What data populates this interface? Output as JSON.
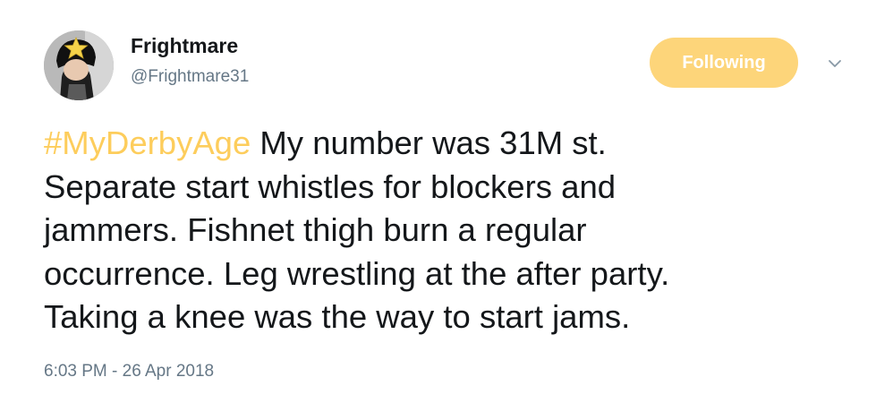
{
  "tweet": {
    "author": {
      "name": "Frightmare",
      "handle": "@Frightmare31"
    },
    "follow_button": {
      "label": "Following",
      "color": "#fdd57a"
    },
    "caret_icon": "chevron-down-icon",
    "text": {
      "hashtag": "#MyDerbyAge",
      "line1_rest": " My number was 31M st.",
      "line2": "Separate start whistles for blockers and",
      "line3": "jammers. Fishnet thigh burn a regular",
      "line4": "occurrence. Leg wrestling at the after party.",
      "line5": "Taking a knee was the way to start jams."
    },
    "hashtag_color": "#fdcd5c",
    "timestamp": "6:03 PM - 26 Apr 2018"
  }
}
